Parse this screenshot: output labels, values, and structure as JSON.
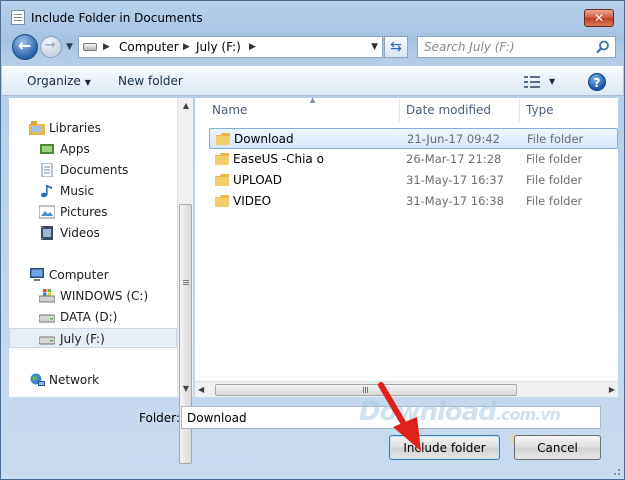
{
  "window": {
    "title": "Include Folder in Documents",
    "close_label": "✕"
  },
  "address_bar": {
    "crumbs": [
      "Computer",
      "July (F:)"
    ]
  },
  "search": {
    "placeholder": "Search July (F:)"
  },
  "toolbar": {
    "organize_label": "Organize",
    "new_folder_label": "New folder",
    "help_label": "?"
  },
  "sidebar": {
    "items": [
      {
        "label": "Libraries",
        "icon": "libraries-icon"
      },
      {
        "label": "Apps",
        "icon": "apps-icon"
      },
      {
        "label": "Documents",
        "icon": "documents-icon"
      },
      {
        "label": "Music",
        "icon": "music-icon"
      },
      {
        "label": "Pictures",
        "icon": "pictures-icon"
      },
      {
        "label": "Videos",
        "icon": "videos-icon"
      },
      {
        "label": "Computer",
        "icon": "computer-icon"
      },
      {
        "label": "WINDOWS (C:)",
        "icon": "windows-drive-icon"
      },
      {
        "label": "DATA (D:)",
        "icon": "drive-icon"
      },
      {
        "label": "July (F:)",
        "icon": "drive-icon",
        "selected": true
      },
      {
        "label": "Network",
        "icon": "network-icon"
      }
    ]
  },
  "file_list": {
    "columns": [
      "Name",
      "Date modified",
      "Type"
    ],
    "rows": [
      {
        "name": "Download",
        "date": "21-Jun-17 09:42",
        "type": "File folder",
        "selected": true
      },
      {
        "name": "EaseUS -Chia o",
        "date": "26-Mar-17 21:28",
        "type": "File folder"
      },
      {
        "name": "UPLOAD",
        "date": "31-May-17 16:37",
        "type": "File folder"
      },
      {
        "name": "VIDEO",
        "date": "31-May-17 16:38",
        "type": "File folder"
      }
    ]
  },
  "footer": {
    "folder_label": "Folder:",
    "folder_value": "Download",
    "include_button": "Include folder",
    "cancel_button": "Cancel"
  },
  "watermark": {
    "text": "Download",
    "suffix": ".com.vn"
  },
  "colors": {
    "accent": "#3c7fb1",
    "selection": "#84acdd",
    "folder": "#e8b94a",
    "annotation_arrow": "#e0201a"
  }
}
